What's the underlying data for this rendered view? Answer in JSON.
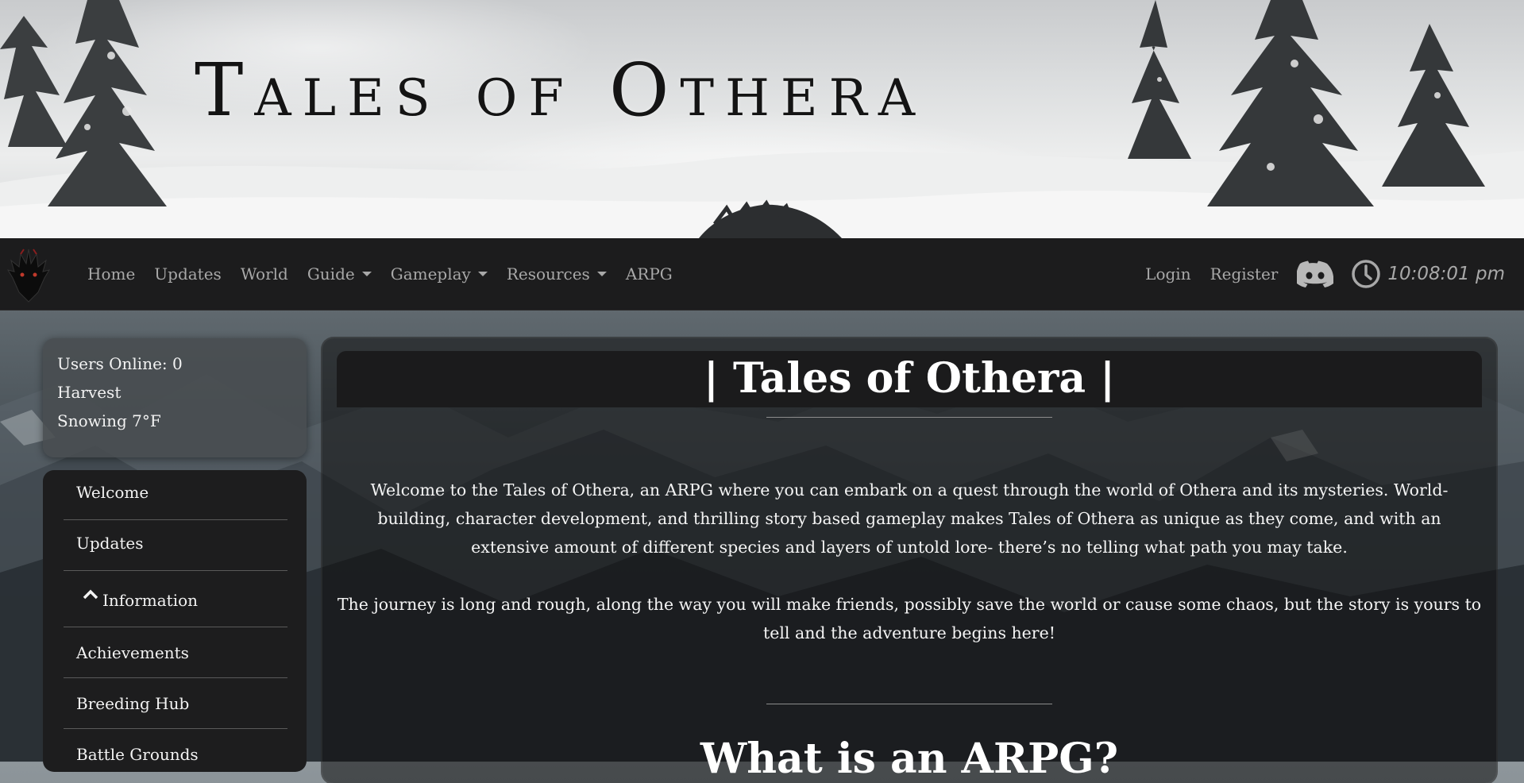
{
  "banner": {
    "title": "Tales of Othera"
  },
  "navbar": {
    "logo_icon": "dragon-head-icon",
    "links": [
      {
        "label": "Home"
      },
      {
        "label": "Updates"
      },
      {
        "label": "World"
      },
      {
        "label": "Guide",
        "dropdown": true
      },
      {
        "label": "Gameplay",
        "dropdown": true
      },
      {
        "label": "Resources",
        "dropdown": true
      },
      {
        "label": "ARPG"
      }
    ],
    "login": "Login",
    "register": "Register",
    "discord_icon": "discord-icon",
    "clock_icon": "clock-icon",
    "time": "10:08:01 pm"
  },
  "status": {
    "users_online": "Users Online: 0",
    "season": "Harvest",
    "weather": "Snowing 7°F"
  },
  "sidebar": {
    "items": [
      {
        "label": "Welcome"
      },
      {
        "label": "Updates"
      },
      {
        "label": "Information",
        "icon": "chevron-up-icon"
      },
      {
        "label": "Achievements"
      },
      {
        "label": "Breeding Hub"
      },
      {
        "label": "Battle Grounds"
      }
    ]
  },
  "main": {
    "title": "| Tales of Othera |",
    "paragraph1": "Welcome to the Tales of Othera, an ARPG where you can embark on a quest through the world of Othera and its mysteries. World-building, character development, and thrilling story based gameplay makes Tales of Othera as unique as they come, and with an extensive amount of different species and layers of untold lore- there’s no telling what path you may take.",
    "paragraph2": "The journey is long and rough, along the way you will make friends, possibly save the world or cause some chaos, but the story is yours to tell and the adventure begins here!",
    "section_title": "What is an ARPG?"
  },
  "colors": {
    "navbar_bg": "#1c1c1d",
    "nav_text": "#a8a8a8",
    "card_bg": "#1d1d1e",
    "text": "#f3f3f3"
  }
}
